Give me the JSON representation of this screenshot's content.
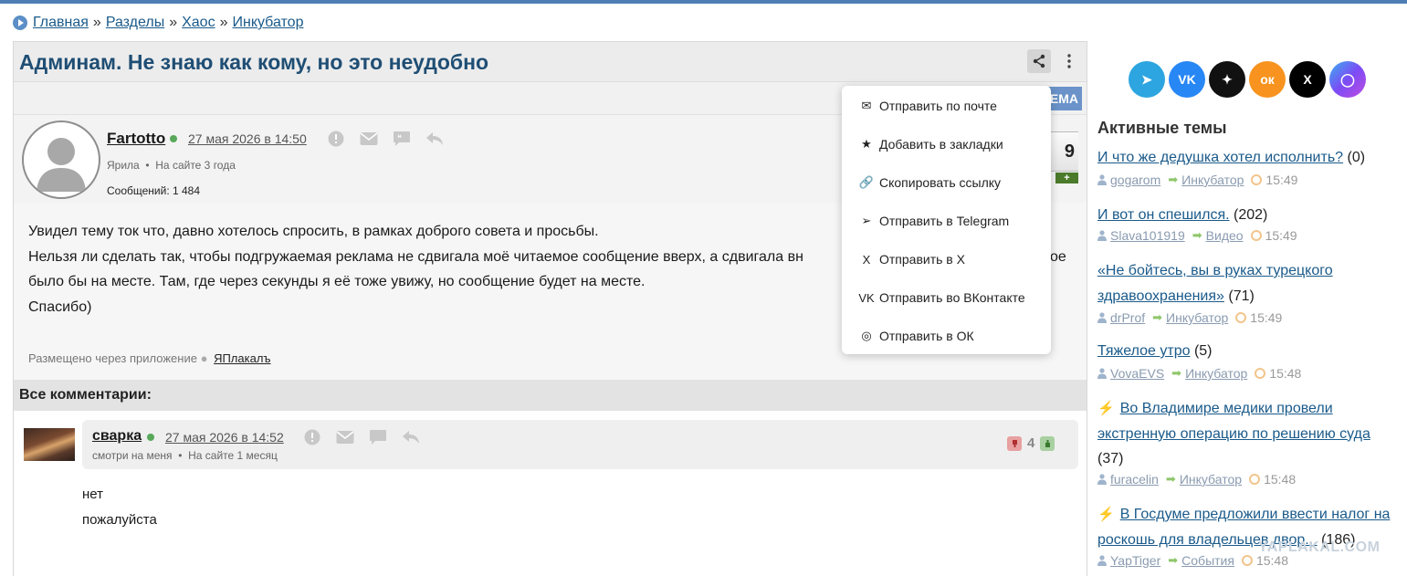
{
  "breadcrumb": {
    "items": [
      "Главная",
      "Разделы",
      "Хаос",
      "Инкубатор"
    ],
    "separator": "»"
  },
  "topic": {
    "title": "Админам. Не знаю как кому, но это неудобно",
    "tema_label": "ЕМА"
  },
  "post": {
    "author": "Fartotto",
    "date": "27 мая 2026 в 14:50",
    "rank": "Ярила",
    "on_site": "На сайте 3 года",
    "messages": "Сообщений: 1 484",
    "rating": "9",
    "rating_plus": "+",
    "body": [
      "Увидел тему ток что, давно хотелось спросить, в рамках доброго совета и просьбы.",
      "Нельзя ли сделать так, чтобы подгружаемая реклама не сдвигала моё читаемое сообщение вверх, а сдвигала вн",
      "было бы на месте. Там, где через секунды я её тоже увижу, но сообщение будет на месте.",
      "Спасибо)"
    ],
    "body_tail": "ое",
    "via_label": "Размещено через приложение",
    "via_app": "ЯПлакалъ"
  },
  "comments": {
    "title": "Все комментарии:",
    "items": [
      {
        "author": "сварка",
        "date": "27 мая 2026 в 14:52",
        "status": "смотри на меня",
        "on_site": "На сайте 1 месяц",
        "score": "4",
        "body": [
          "нет",
          "пожалуйста"
        ]
      }
    ]
  },
  "share_menu": {
    "items": [
      {
        "icon": "envelope-icon",
        "glyph": "✉",
        "label": "Отправить по почте"
      },
      {
        "icon": "star-icon",
        "glyph": "★",
        "label": "Добавить в закладки"
      },
      {
        "icon": "link-icon",
        "glyph": "🔗",
        "label": "Скопировать ссылку"
      },
      {
        "icon": "telegram-icon",
        "glyph": "➢",
        "label": "Отправить в Telegram"
      },
      {
        "icon": "x-icon",
        "glyph": "X",
        "label": "Отправить в X"
      },
      {
        "icon": "vk-icon",
        "glyph": "VK",
        "label": "Отправить во ВКонтакте"
      },
      {
        "icon": "ok-icon",
        "glyph": "◎",
        "label": "Отправить в ОК"
      }
    ]
  },
  "sidebar": {
    "socials": [
      {
        "name": "telegram-icon",
        "color": "#2ca5e0",
        "glyph": "➤"
      },
      {
        "name": "vk-icon",
        "color": "#2787f5",
        "glyph": "VK"
      },
      {
        "name": "dzen-icon",
        "color": "#111111",
        "glyph": "✦"
      },
      {
        "name": "odnoklassniki-icon",
        "color": "#f7931e",
        "glyph": "ок"
      },
      {
        "name": "x-icon",
        "color": "#000000",
        "glyph": "X"
      },
      {
        "name": "max-icon",
        "color": "#7b4cf5",
        "glyph": "◯"
      }
    ],
    "title": "Активные темы",
    "topics": [
      {
        "title": "И что же дедушка хотел исполнить?",
        "count": "(0)",
        "user": "gogarom",
        "category": "Инкубатор",
        "time": "15:49",
        "pinned": false
      },
      {
        "title": "И вот он спешился.",
        "count": "(202)",
        "user": "Slava101919",
        "category": "Видео",
        "time": "15:49",
        "pinned": false
      },
      {
        "title": "«Не бойтесь, вы в руках турецкого здравоохранения»",
        "count": "(71)",
        "user": "drProf",
        "category": "Инкубатор",
        "time": "15:49",
        "pinned": false
      },
      {
        "title": "Тяжелое утро",
        "count": "(5)",
        "user": "VovaEVS",
        "category": "Инкубатор",
        "time": "15:48",
        "pinned": false
      },
      {
        "title": "Во Владимире медики провели экстренную операцию по решению суда",
        "count": "(37)",
        "user": "furacelin",
        "category": "Инкубатор",
        "time": "15:48",
        "pinned": true
      },
      {
        "title": "В Госдуме предложили ввести налог на роскошь для владельцев двор...",
        "count": "(186)",
        "user": "YapTiger",
        "category": "События",
        "time": "15:48",
        "pinned": true
      }
    ],
    "watermark": "YAPLAKAL.COM"
  },
  "colors": {
    "accent": "#4d7fb5",
    "title": "#1f4e74",
    "link": "#1a5a8a",
    "online": "#58a85a"
  }
}
